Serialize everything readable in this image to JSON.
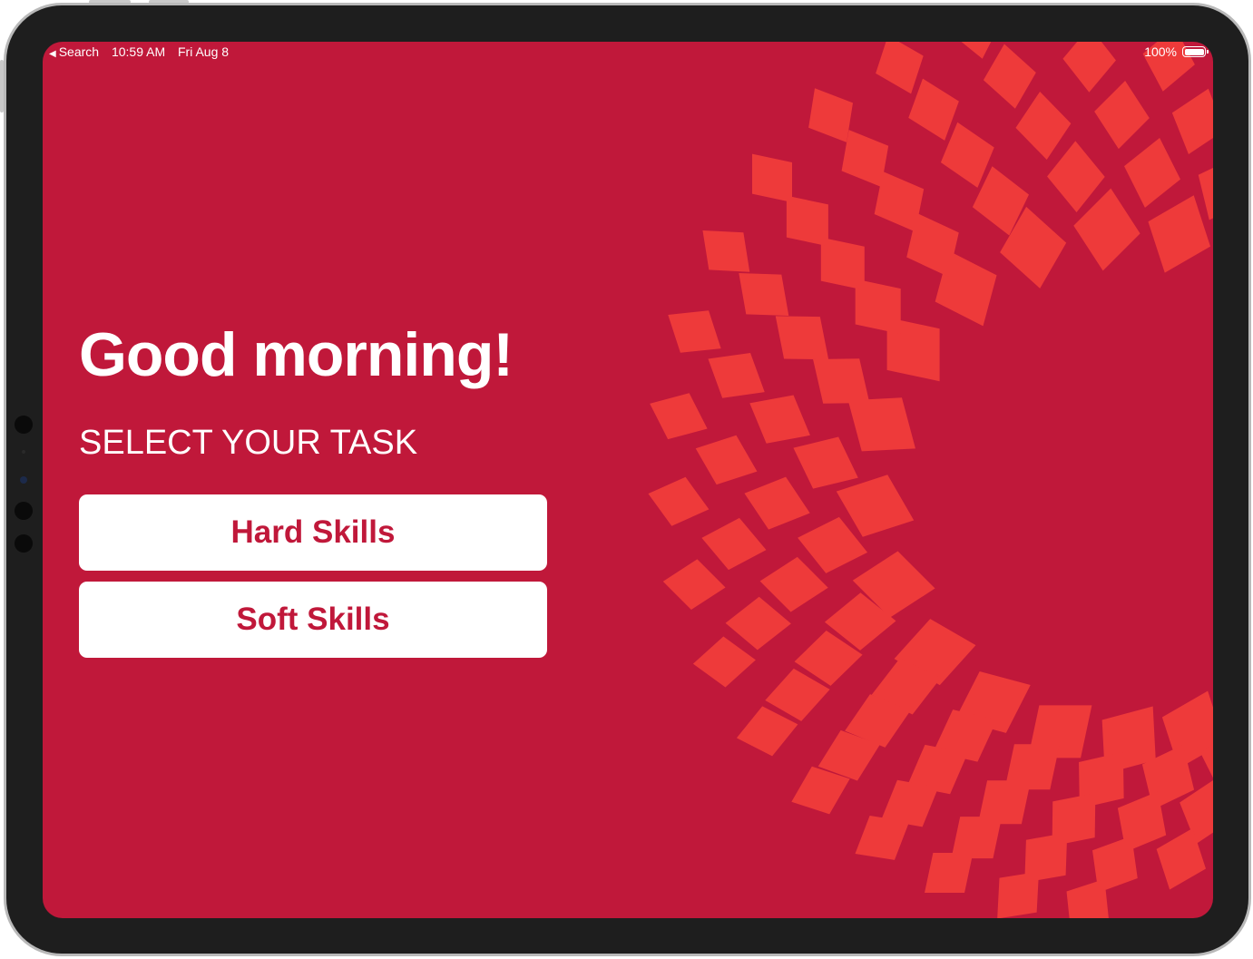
{
  "status_bar": {
    "back_app": "Search",
    "time": "10:59 AM",
    "date": "Fri Aug 8",
    "battery": "100%"
  },
  "main": {
    "greeting": "Good morning!",
    "subtitle": "SELECT YOUR TASK",
    "buttons": [
      {
        "label": "Hard Skills"
      },
      {
        "label": "Soft Skills"
      }
    ]
  },
  "colors": {
    "background": "#c0183a",
    "pattern": "#ee3a3a",
    "button_text": "#c0183a",
    "button_bg": "#ffffff"
  }
}
